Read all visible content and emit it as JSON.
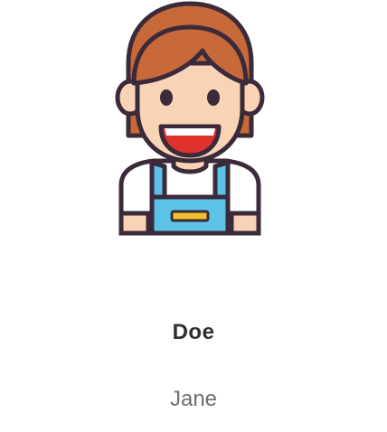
{
  "profile": {
    "last_name": "Doe",
    "first_name": "Jane",
    "avatar_icon": "worker-woman-avatar-icon"
  },
  "colors": {
    "hair": "#c8693a",
    "skin": "#f8d3b6",
    "outline": "#3b2a3a",
    "overalls": "#5cc3e6",
    "shirt": "#ffffff",
    "mouth": "#e0312d",
    "pocket_stripe": "#f2c12e"
  }
}
